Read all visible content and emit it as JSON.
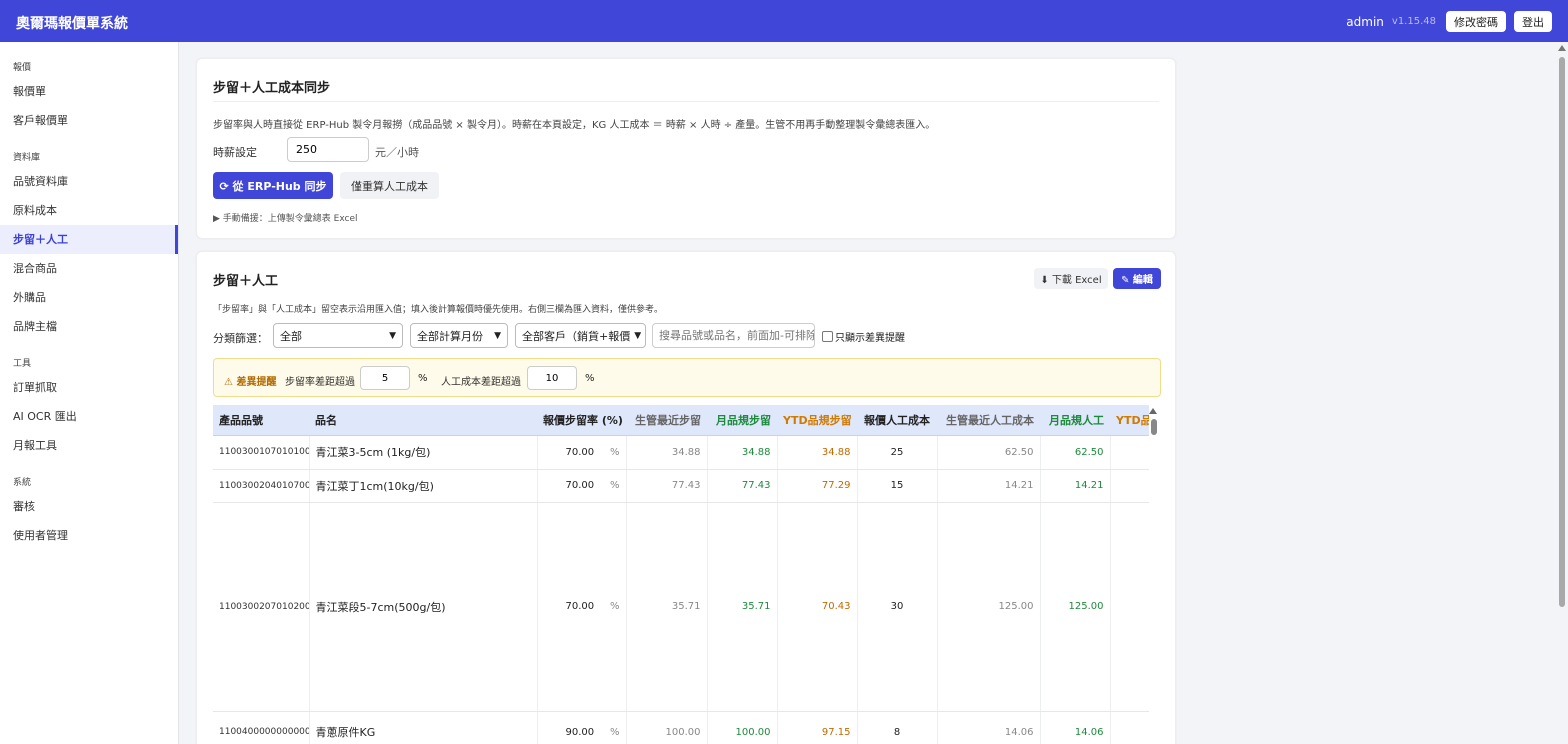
{
  "header": {
    "brand": "奧爾瑪報價單系統",
    "user": "admin",
    "version": "v1.15.48",
    "change_password": "修改密碼",
    "logout": "登出"
  },
  "sidebar": {
    "groups": [
      {
        "title": "報價",
        "items": [
          "報價單",
          "客戶報價單"
        ]
      },
      {
        "title": "資料庫",
        "items": [
          "品號資料庫",
          "原料成本",
          "步留＋人工",
          "混合商品",
          "外購品",
          "品牌主檔"
        ]
      },
      {
        "title": "工具",
        "items": [
          "訂單抓取",
          "AI OCR 匯出",
          "月報工具"
        ]
      },
      {
        "title": "系統",
        "items": [
          "審核",
          "使用者管理"
        ]
      }
    ],
    "active": "步留＋人工"
  },
  "sync_card": {
    "title": "步留＋人工成本同步",
    "description": "步留率與人時直接從 ERP-Hub 製令月報撈（成品品號 × 製令月）。時薪在本頁設定，KG 人工成本 ＝ 時薪 × 人時 ÷ 產量。生管不用再手動整理製令彙總表匯入。",
    "rate_label": "時薪設定",
    "rate_value": "250",
    "rate_unit": "元／小時",
    "sync_button": "⟳ 從 ERP-Hub 同步",
    "recalc_button": "僅重算人工成本",
    "manual_backup": "▶ 手動備援：上傳製令彙總表 Excel"
  },
  "list_card": {
    "title": "步留＋人工",
    "download_button": "⬇ 下載 Excel",
    "edit_button": "✎ 編輯",
    "description": "「步留率」與「人工成本」留空表示沿用匯入值；填入後計算報價時優先使用。右側三欄為匯入資料，僅供參考。",
    "filter_label": "分類篩選：",
    "filters": {
      "category": "全部",
      "month": "全部計算月份",
      "customer": "全部客戶（銷貨+報價"
    },
    "search_placeholder": "搜尋品號或品名，前面加-可排除",
    "only_diff_label": "只顯示差異提醒",
    "warning": {
      "title": "⚠ 差異提醒",
      "yield_label": "步留率差距超過",
      "yield_value": "5",
      "percent1": "%",
      "labor_label": "人工成本差距超過",
      "labor_value": "10",
      "percent2": "%"
    },
    "table": {
      "headers": [
        "產品品號",
        "品名",
        "報價步留率 (%)",
        "生管最近步留",
        "月品規步留",
        "YTD品規步留",
        "報價人工成本",
        "生管最近人工成本",
        "月品規人工",
        "YTD品規人工"
      ],
      "rows": [
        {
          "code": "1100300107010100",
          "name": "青江菜3-5cm (1kg/包)",
          "yield": "70.00",
          "pct": "%",
          "recent_yield": "34.88",
          "month_yield": "34.88",
          "ytd_yield": "34.88",
          "labor": "25",
          "recent_labor": "62.50",
          "month_labor": "62.50",
          "ytd_labor": ""
        },
        {
          "code": "1100300204010700",
          "name": "青江菜丁1cm(10kg/包)",
          "yield": "70.00",
          "pct": "%",
          "recent_yield": "77.43",
          "month_yield": "77.43",
          "ytd_yield": "77.29",
          "labor": "15",
          "recent_labor": "14.21",
          "month_labor": "14.21",
          "ytd_labor": ""
        },
        {
          "code": "1100300207010200",
          "name": "青江菜段5-7cm(500g/包)",
          "yield": "70.00",
          "pct": "%",
          "recent_yield": "35.71",
          "month_yield": "35.71",
          "ytd_yield": "70.43",
          "labor": "30",
          "recent_labor": "125.00",
          "month_labor": "125.00",
          "ytd_labor": ""
        },
        {
          "code": "1100400000000000",
          "name": "青蔥原件KG",
          "yield": "90.00",
          "pct": "%",
          "recent_yield": "100.00",
          "month_yield": "100.00",
          "ytd_yield": "97.15",
          "labor": "8",
          "recent_labor": "14.06",
          "month_labor": "14.06",
          "ytd_labor": ""
        }
      ]
    }
  },
  "colors": {
    "primary": "#4046d8",
    "green": "#1e8a3c",
    "orange": "#d07a00",
    "warn_bg": "#fffbea"
  }
}
